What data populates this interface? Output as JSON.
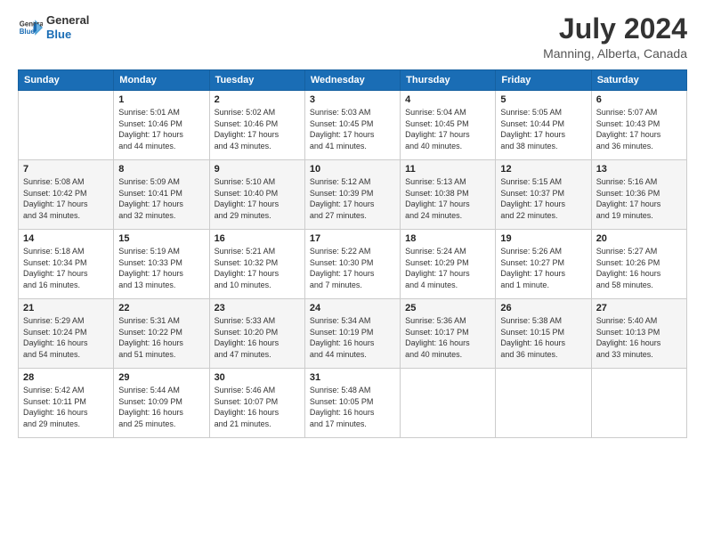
{
  "logo": {
    "line1": "General",
    "line2": "Blue"
  },
  "title": "July 2024",
  "location": "Manning, Alberta, Canada",
  "header": {
    "days": [
      "Sunday",
      "Monday",
      "Tuesday",
      "Wednesday",
      "Thursday",
      "Friday",
      "Saturday"
    ]
  },
  "weeks": [
    [
      {
        "day": "",
        "info": ""
      },
      {
        "day": "1",
        "info": "Sunrise: 5:01 AM\nSunset: 10:46 PM\nDaylight: 17 hours\nand 44 minutes."
      },
      {
        "day": "2",
        "info": "Sunrise: 5:02 AM\nSunset: 10:46 PM\nDaylight: 17 hours\nand 43 minutes."
      },
      {
        "day": "3",
        "info": "Sunrise: 5:03 AM\nSunset: 10:45 PM\nDaylight: 17 hours\nand 41 minutes."
      },
      {
        "day": "4",
        "info": "Sunrise: 5:04 AM\nSunset: 10:45 PM\nDaylight: 17 hours\nand 40 minutes."
      },
      {
        "day": "5",
        "info": "Sunrise: 5:05 AM\nSunset: 10:44 PM\nDaylight: 17 hours\nand 38 minutes."
      },
      {
        "day": "6",
        "info": "Sunrise: 5:07 AM\nSunset: 10:43 PM\nDaylight: 17 hours\nand 36 minutes."
      }
    ],
    [
      {
        "day": "7",
        "info": "Sunrise: 5:08 AM\nSunset: 10:42 PM\nDaylight: 17 hours\nand 34 minutes."
      },
      {
        "day": "8",
        "info": "Sunrise: 5:09 AM\nSunset: 10:41 PM\nDaylight: 17 hours\nand 32 minutes."
      },
      {
        "day": "9",
        "info": "Sunrise: 5:10 AM\nSunset: 10:40 PM\nDaylight: 17 hours\nand 29 minutes."
      },
      {
        "day": "10",
        "info": "Sunrise: 5:12 AM\nSunset: 10:39 PM\nDaylight: 17 hours\nand 27 minutes."
      },
      {
        "day": "11",
        "info": "Sunrise: 5:13 AM\nSunset: 10:38 PM\nDaylight: 17 hours\nand 24 minutes."
      },
      {
        "day": "12",
        "info": "Sunrise: 5:15 AM\nSunset: 10:37 PM\nDaylight: 17 hours\nand 22 minutes."
      },
      {
        "day": "13",
        "info": "Sunrise: 5:16 AM\nSunset: 10:36 PM\nDaylight: 17 hours\nand 19 minutes."
      }
    ],
    [
      {
        "day": "14",
        "info": "Sunrise: 5:18 AM\nSunset: 10:34 PM\nDaylight: 17 hours\nand 16 minutes."
      },
      {
        "day": "15",
        "info": "Sunrise: 5:19 AM\nSunset: 10:33 PM\nDaylight: 17 hours\nand 13 minutes."
      },
      {
        "day": "16",
        "info": "Sunrise: 5:21 AM\nSunset: 10:32 PM\nDaylight: 17 hours\nand 10 minutes."
      },
      {
        "day": "17",
        "info": "Sunrise: 5:22 AM\nSunset: 10:30 PM\nDaylight: 17 hours\nand 7 minutes."
      },
      {
        "day": "18",
        "info": "Sunrise: 5:24 AM\nSunset: 10:29 PM\nDaylight: 17 hours\nand 4 minutes."
      },
      {
        "day": "19",
        "info": "Sunrise: 5:26 AM\nSunset: 10:27 PM\nDaylight: 17 hours\nand 1 minute."
      },
      {
        "day": "20",
        "info": "Sunrise: 5:27 AM\nSunset: 10:26 PM\nDaylight: 16 hours\nand 58 minutes."
      }
    ],
    [
      {
        "day": "21",
        "info": "Sunrise: 5:29 AM\nSunset: 10:24 PM\nDaylight: 16 hours\nand 54 minutes."
      },
      {
        "day": "22",
        "info": "Sunrise: 5:31 AM\nSunset: 10:22 PM\nDaylight: 16 hours\nand 51 minutes."
      },
      {
        "day": "23",
        "info": "Sunrise: 5:33 AM\nSunset: 10:20 PM\nDaylight: 16 hours\nand 47 minutes."
      },
      {
        "day": "24",
        "info": "Sunrise: 5:34 AM\nSunset: 10:19 PM\nDaylight: 16 hours\nand 44 minutes."
      },
      {
        "day": "25",
        "info": "Sunrise: 5:36 AM\nSunset: 10:17 PM\nDaylight: 16 hours\nand 40 minutes."
      },
      {
        "day": "26",
        "info": "Sunrise: 5:38 AM\nSunset: 10:15 PM\nDaylight: 16 hours\nand 36 minutes."
      },
      {
        "day": "27",
        "info": "Sunrise: 5:40 AM\nSunset: 10:13 PM\nDaylight: 16 hours\nand 33 minutes."
      }
    ],
    [
      {
        "day": "28",
        "info": "Sunrise: 5:42 AM\nSunset: 10:11 PM\nDaylight: 16 hours\nand 29 minutes."
      },
      {
        "day": "29",
        "info": "Sunrise: 5:44 AM\nSunset: 10:09 PM\nDaylight: 16 hours\nand 25 minutes."
      },
      {
        "day": "30",
        "info": "Sunrise: 5:46 AM\nSunset: 10:07 PM\nDaylight: 16 hours\nand 21 minutes."
      },
      {
        "day": "31",
        "info": "Sunrise: 5:48 AM\nSunset: 10:05 PM\nDaylight: 16 hours\nand 17 minutes."
      },
      {
        "day": "",
        "info": ""
      },
      {
        "day": "",
        "info": ""
      },
      {
        "day": "",
        "info": ""
      }
    ]
  ]
}
